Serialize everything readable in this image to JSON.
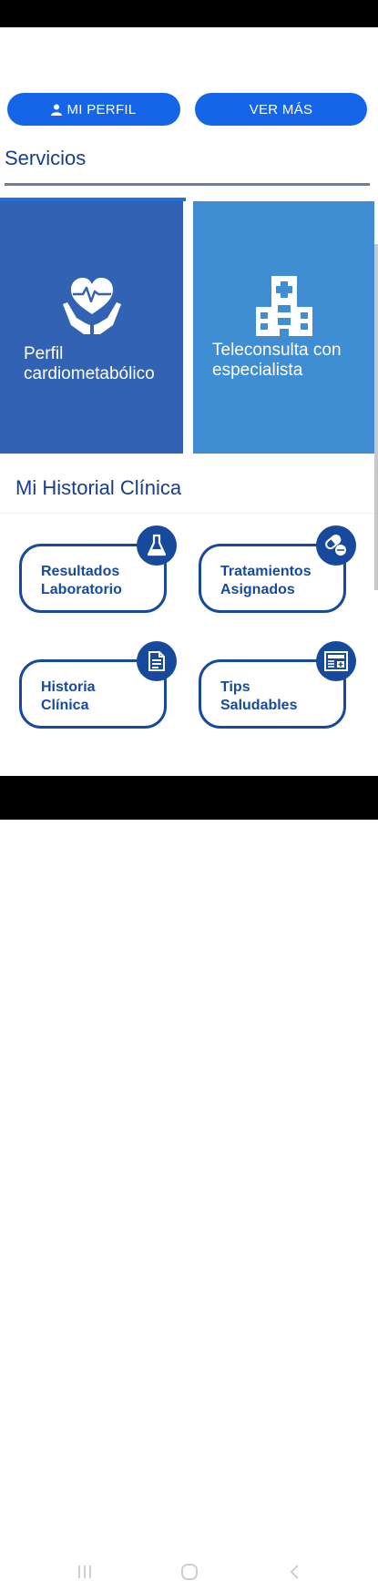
{
  "header": {
    "profile_button": "MI PERFIL",
    "more_button": "VER MÁS"
  },
  "services": {
    "title": "Servicios",
    "tiles": [
      {
        "label": "Perfil cardiometabólico",
        "icon": "heart-hands-icon",
        "color": "#3262b4"
      },
      {
        "label": "Teleconsulta con especialista",
        "icon": "hospital-icon",
        "color": "#3f8ed4"
      }
    ]
  },
  "history": {
    "title": "Mi Historial Clínica",
    "cards": [
      {
        "label": "Resultados Laboratorio",
        "icon": "flask-icon"
      },
      {
        "label": "Tratamientos Asignados",
        "icon": "pills-icon"
      },
      {
        "label": "Historia Clínica",
        "icon": "document-icon"
      },
      {
        "label": "Tips Saludables",
        "icon": "newspaper-icon"
      }
    ]
  },
  "colors": {
    "primary_button": "#1565e8",
    "card_border": "#174a9c",
    "title_text": "#1a3c8c"
  }
}
